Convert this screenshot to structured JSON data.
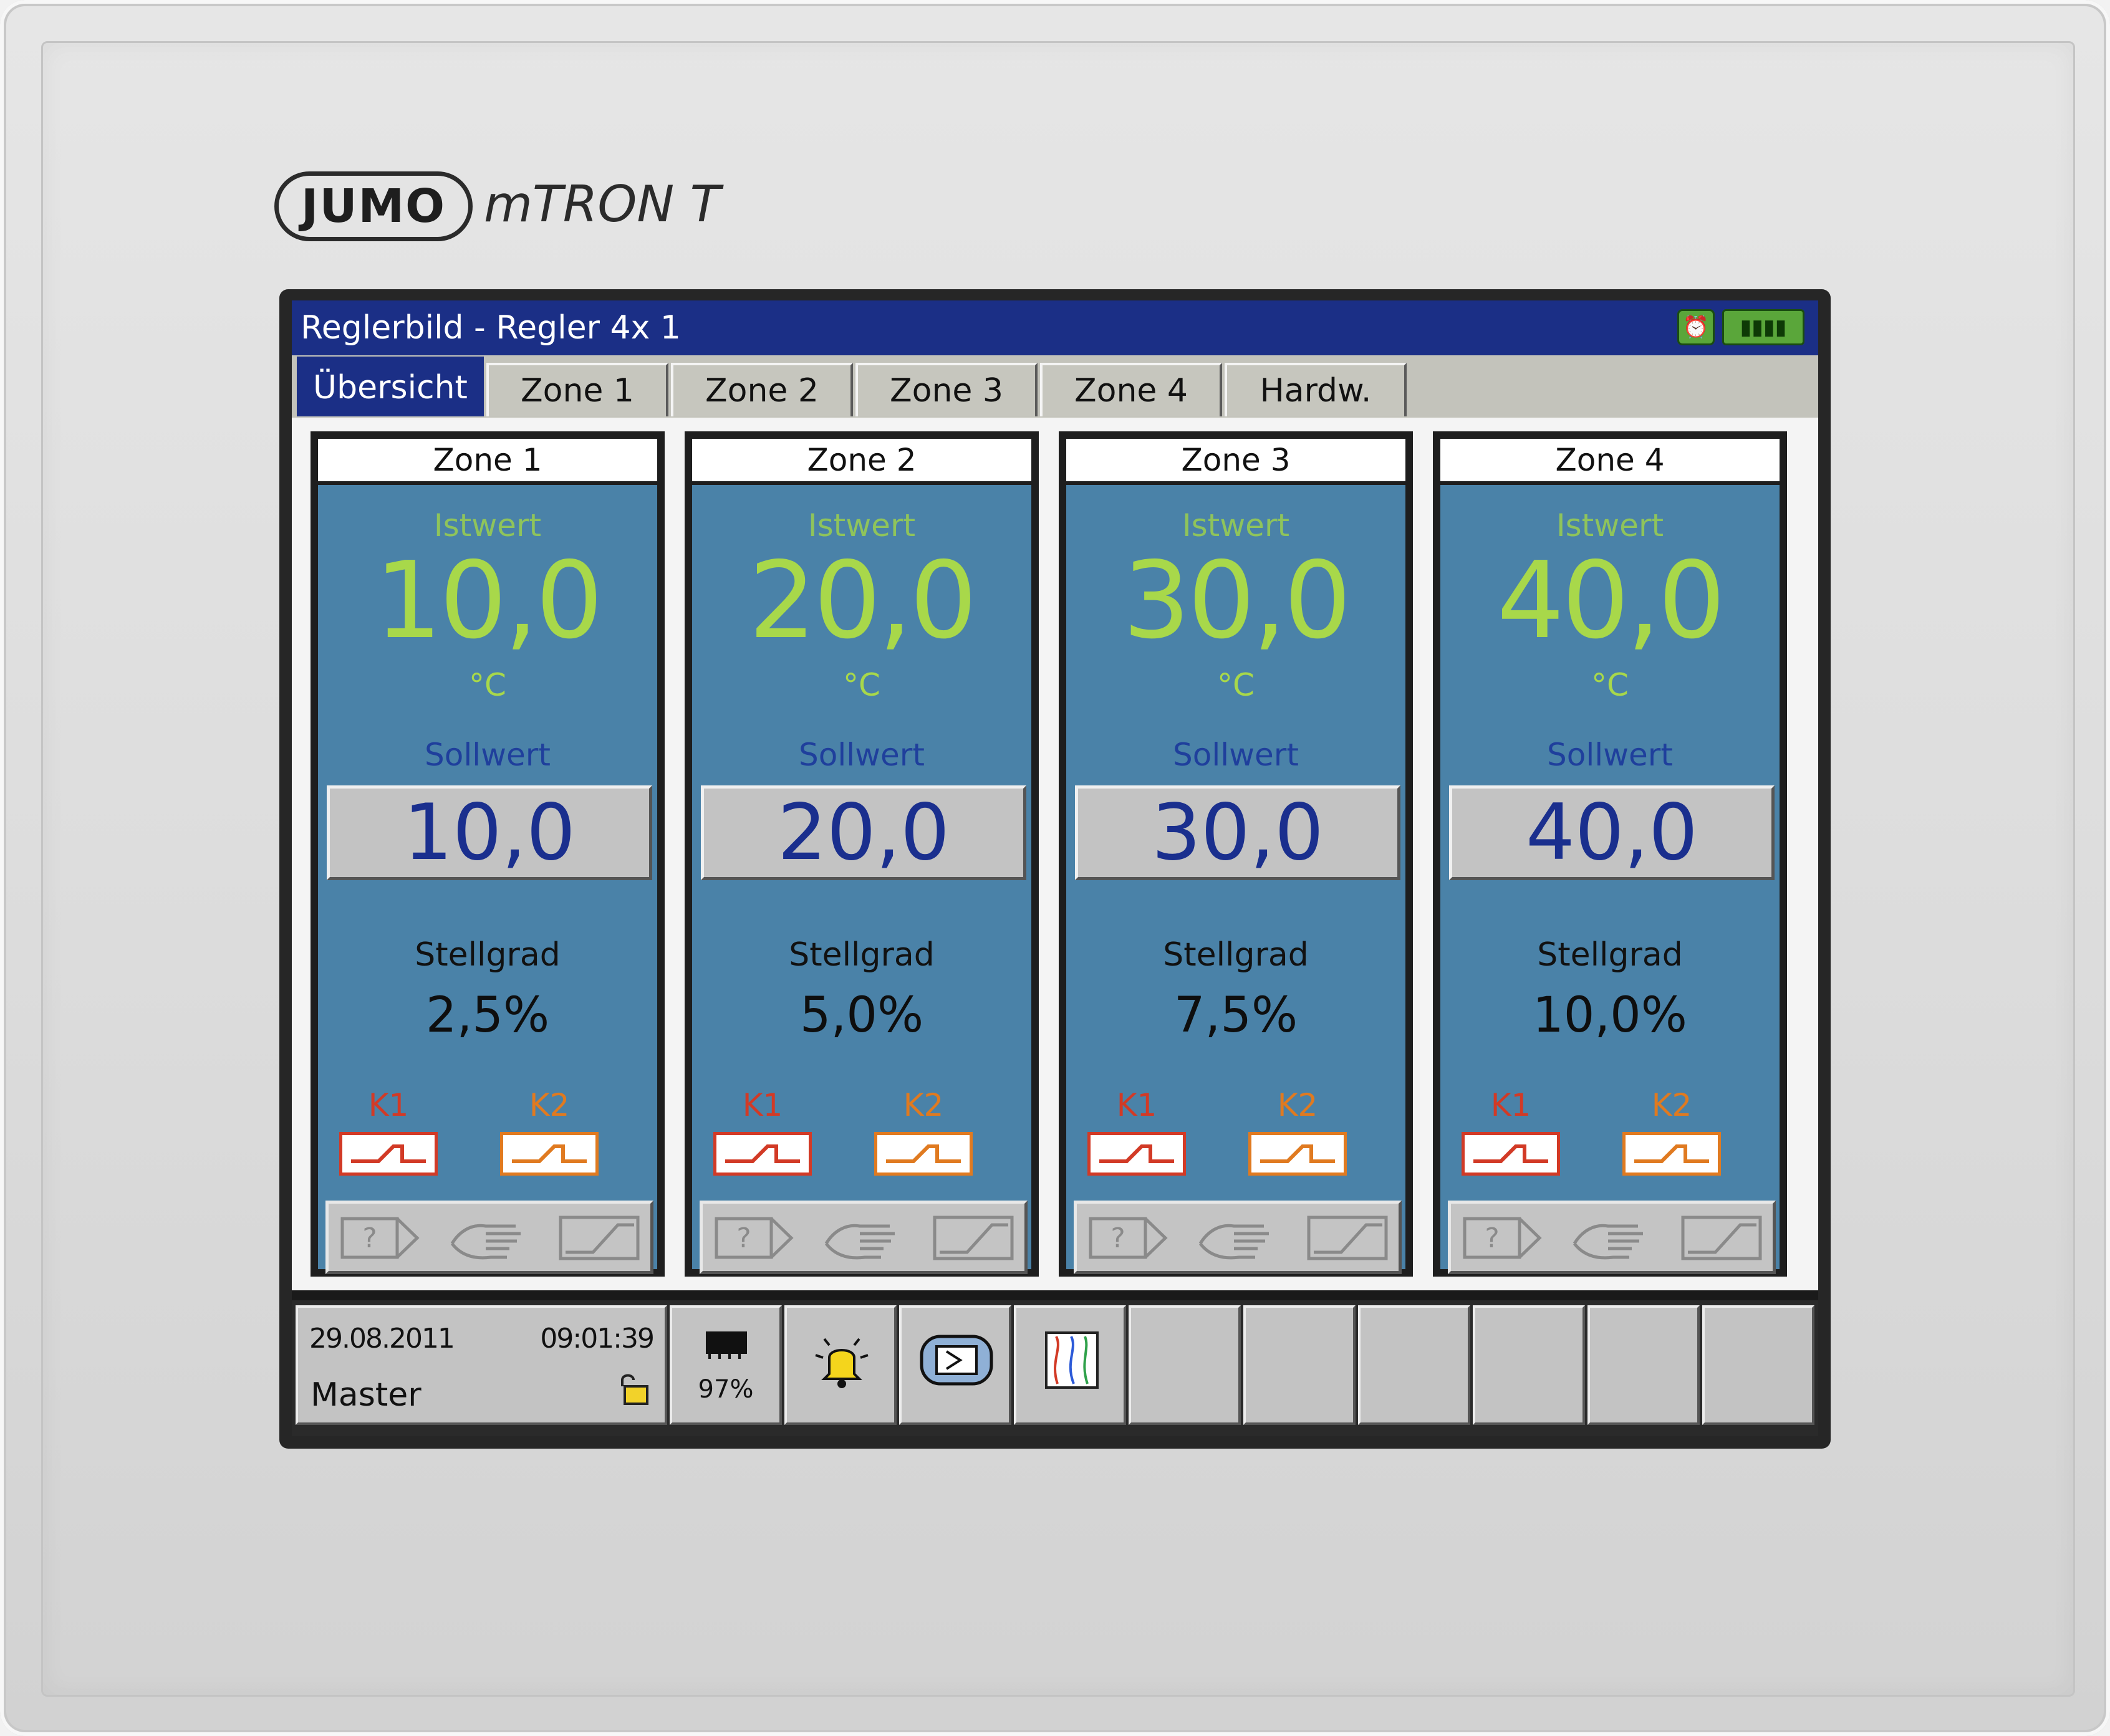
{
  "brand": {
    "logo": "JUMO",
    "model": "mTRON T"
  },
  "window": {
    "title": "Reglerbild - Regler 4x 1",
    "status_icons": [
      "alarm-clock-icon",
      "battery-icon"
    ]
  },
  "tabs": [
    "Übersicht",
    "Zone 1",
    "Zone 2",
    "Zone 3",
    "Zone 4",
    "Hardw."
  ],
  "active_tab": "Übersicht",
  "zones": [
    {
      "name": "Zone 1",
      "istwert_label": "Istwert",
      "istwert": "10,0",
      "unit": "°C",
      "sollwert_label": "Sollwert",
      "sollwert": "10,0",
      "stellgrad_label": "Stellgrad",
      "stellgrad": "2,5%",
      "k1": "K1",
      "k2": "K2"
    },
    {
      "name": "Zone 2",
      "istwert_label": "Istwert",
      "istwert": "20,0",
      "unit": "°C",
      "sollwert_label": "Sollwert",
      "sollwert": "20,0",
      "stellgrad_label": "Stellgrad",
      "stellgrad": "5,0%",
      "k1": "K1",
      "k2": "K2"
    },
    {
      "name": "Zone 3",
      "istwert_label": "Istwert",
      "istwert": "30,0",
      "unit": "°C",
      "sollwert_label": "Sollwert",
      "sollwert": "30,0",
      "stellgrad_label": "Stellgrad",
      "stellgrad": "7,5%",
      "k1": "K1",
      "k2": "K2"
    },
    {
      "name": "Zone 4",
      "istwert_label": "Istwert",
      "istwert": "40,0",
      "unit": "°C",
      "sollwert_label": "Sollwert",
      "sollwert": "40,0",
      "stellgrad_label": "Stellgrad",
      "stellgrad": "10,0%",
      "k1": "K1",
      "k2": "K2"
    }
  ],
  "zone_buttons": [
    "help-icon",
    "manual-hand-icon",
    "ramp-icon"
  ],
  "footer": {
    "date": "29.08.2011",
    "time": "09:01:39",
    "user": "Master",
    "memory_percent": "97%",
    "icons": [
      "padlock-open-icon",
      "memory-chip-icon",
      "alarm-bell-icon",
      "login-icon",
      "recorder-chart-icon"
    ]
  },
  "colors": {
    "title_bar": "#1b2f86",
    "zone_bg": "#4a82a8",
    "istwert": "#a8d84a",
    "sollwert": "#1a2f8e",
    "k1": "#d23a26",
    "k2": "#e07a20"
  }
}
